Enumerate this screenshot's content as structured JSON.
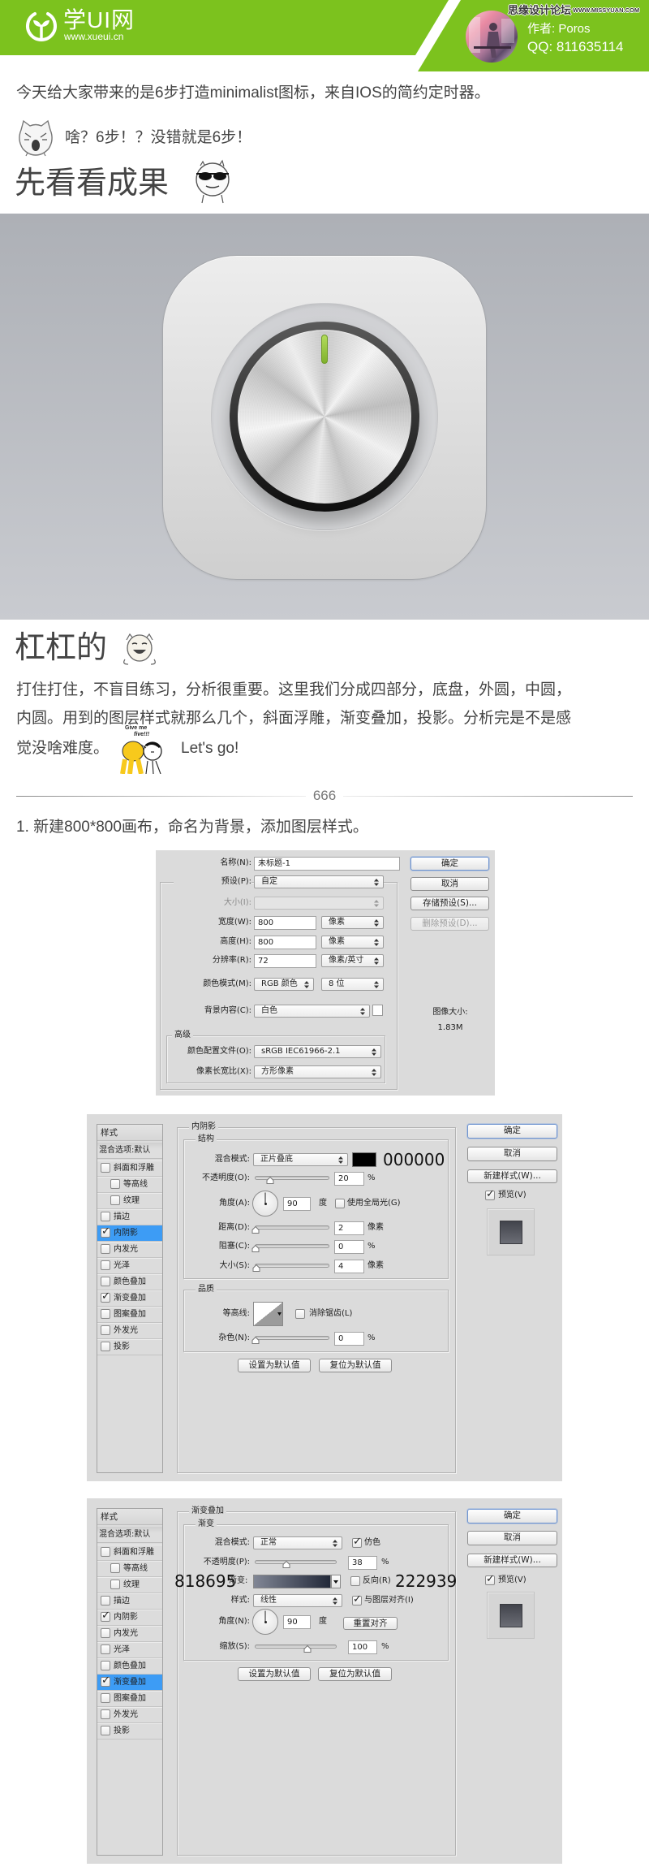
{
  "header": {
    "brand_color": "#7cc21e",
    "logo_text": "学UI网",
    "logo_domain": "www.xueui.cn",
    "forum_name": "思缘设计论坛",
    "forum_domain": "WWW.MISSYUAN.COM",
    "author_label": "作者:",
    "author_name": "Poros",
    "qq_label": "QQ:",
    "qq_number": "811635114"
  },
  "intro": {
    "line1": "今天给大家带来的是6步打造minimalist图标，来自IOS的简约定时器。",
    "line2": "啥？6步！？没错就是6步！"
  },
  "result_section": {
    "title": "先看看成果"
  },
  "analysis_section": {
    "title": "杠杠的",
    "lines": [
      "打住打住，不盲目练习，分析很重要。这里我们分成四部分，底盘，外圆，中圆，",
      "内圆。用到的图层样式就那么几个，斜面浮雕，渐变叠加，投影。分析完是不是感",
      "觉没啥难度。"
    ],
    "sticker_caption": [
      "Give me",
      "five!!!"
    ],
    "closing": "Let's go!"
  },
  "divider": {
    "label": "666"
  },
  "step1": {
    "text": "1. 新建800*800画布，命名为背景，添加图层样式。"
  },
  "new_doc_dialog": {
    "name": {
      "label": "名称(N):",
      "value": "未标题-1"
    },
    "preset": {
      "label": "预设(P):",
      "value": "自定"
    },
    "size": {
      "label": "大小(I):",
      "value": ""
    },
    "width": {
      "label": "宽度(W):",
      "value": "800",
      "unit": "像素"
    },
    "height": {
      "label": "高度(H):",
      "value": "800",
      "unit": "像素"
    },
    "resolution": {
      "label": "分辨率(R):",
      "value": "72",
      "unit": "像素/英寸"
    },
    "color_mode": {
      "label": "颜色模式(M):",
      "value": "RGB 颜色",
      "depth": "8 位"
    },
    "background": {
      "label": "背景内容(C):",
      "value": "白色",
      "swatch_color": "#ffffff"
    },
    "advanced": {
      "label": "高级",
      "color_profile": {
        "label": "颜色配置文件(O):",
        "value": "sRGB IEC61966-2.1"
      },
      "pixel_aspect": {
        "label": "像素长宽比(X):",
        "value": "方形像素"
      }
    },
    "buttons": {
      "ok": "确定",
      "cancel": "取消",
      "save_preset": "存储预设(S)...",
      "delete_preset": "删除预设(D)..."
    },
    "image_size": {
      "label": "图像大小:",
      "value": "1.83M"
    }
  },
  "inner_shadow_dialog": {
    "styles_header": "样式",
    "blending_options": "混合选项:默认",
    "styles": [
      {
        "label": "斜面和浮雕",
        "checked": false,
        "indent": false,
        "selected": false
      },
      {
        "label": "等高线",
        "checked": false,
        "indent": true,
        "selected": false
      },
      {
        "label": "纹理",
        "checked": false,
        "indent": true,
        "selected": false
      },
      {
        "label": "描边",
        "checked": false,
        "indent": false,
        "selected": false
      },
      {
        "label": "内阴影",
        "checked": true,
        "indent": false,
        "selected": true
      },
      {
        "label": "内发光",
        "checked": false,
        "indent": false,
        "selected": false
      },
      {
        "label": "光泽",
        "checked": false,
        "indent": false,
        "selected": false
      },
      {
        "label": "颜色叠加",
        "checked": false,
        "indent": false,
        "selected": false
      },
      {
        "label": "渐变叠加",
        "checked": true,
        "indent": false,
        "selected": false
      },
      {
        "label": "图案叠加",
        "checked": false,
        "indent": false,
        "selected": false
      },
      {
        "label": "外发光",
        "checked": false,
        "indent": false,
        "selected": false
      },
      {
        "label": "投影",
        "checked": false,
        "indent": false,
        "selected": false
      }
    ],
    "panel_title": "内阴影",
    "structure": {
      "title": "结构",
      "blend_mode": {
        "label": "混合模式:",
        "value": "正片叠底",
        "color": "#000000",
        "color_note": "000000"
      },
      "opacity": {
        "label": "不透明度(O):",
        "value": 20,
        "min": 0,
        "max": 100,
        "unit": "%"
      },
      "angle": {
        "label": "角度(A):",
        "value": 90,
        "unit": "度",
        "global_light": {
          "label": "使用全局光(G)",
          "checked": false
        }
      },
      "distance": {
        "label": "距离(D):",
        "value": 2,
        "min": 0,
        "max": 30000,
        "unit": "像素"
      },
      "choke": {
        "label": "阻塞(C):",
        "value": 0,
        "min": 0,
        "max": 100,
        "unit": "%"
      },
      "size": {
        "label": "大小(S):",
        "value": 4,
        "min": 0,
        "max": 250,
        "unit": "像素"
      }
    },
    "quality": {
      "title": "品质",
      "contour": {
        "label": "等高线:",
        "anti_alias": {
          "label": "消除锯齿(L)",
          "checked": false
        }
      },
      "noise": {
        "label": "杂色(N):",
        "value": 0,
        "min": 0,
        "max": 100,
        "unit": "%"
      }
    },
    "buttons": {
      "make_default": "设置为默认值",
      "reset_default": "复位为默认值",
      "ok": "确定",
      "cancel": "取消",
      "new_style": "新建样式(W)..."
    },
    "preview": {
      "label": "预览(V)",
      "checked": true
    }
  },
  "gradient_overlay_dialog": {
    "styles_header": "样式",
    "blending_options": "混合选项:默认",
    "styles": [
      {
        "label": "斜面和浮雕",
        "checked": false,
        "indent": false,
        "selected": false
      },
      {
        "label": "等高线",
        "checked": false,
        "indent": true,
        "selected": false
      },
      {
        "label": "纹理",
        "checked": false,
        "indent": true,
        "selected": false
      },
      {
        "label": "描边",
        "checked": false,
        "indent": false,
        "selected": false
      },
      {
        "label": "内阴影",
        "checked": true,
        "indent": false,
        "selected": false
      },
      {
        "label": "内发光",
        "checked": false,
        "indent": false,
        "selected": false
      },
      {
        "label": "光泽",
        "checked": false,
        "indent": false,
        "selected": false
      },
      {
        "label": "颜色叠加",
        "checked": false,
        "indent": false,
        "selected": false
      },
      {
        "label": "渐变叠加",
        "checked": true,
        "indent": false,
        "selected": true
      },
      {
        "label": "图案叠加",
        "checked": false,
        "indent": false,
        "selected": false
      },
      {
        "label": "外发光",
        "checked": false,
        "indent": false,
        "selected": false
      },
      {
        "label": "投影",
        "checked": false,
        "indent": false,
        "selected": false
      }
    ],
    "panel_title": "渐变叠加",
    "gradient_group": {
      "title": "渐变",
      "blend_mode": {
        "label": "混合模式:",
        "value": "正常",
        "dither": {
          "label": "仿色",
          "checked": true
        }
      },
      "opacity": {
        "label": "不透明度(P):",
        "value": 38,
        "min": 0,
        "max": 100,
        "unit": "%"
      },
      "gradient": {
        "label": "渐变:",
        "start_color": "#818695",
        "end_color": "#222939",
        "start_note": "818695",
        "end_note": "222939",
        "reverse": {
          "label": "反向(R)",
          "checked": false
        }
      },
      "style": {
        "label": "样式:",
        "value": "线性",
        "align": {
          "label": "与图层对齐(I)",
          "checked": true
        }
      },
      "angle": {
        "label": "角度(N):",
        "value": 90,
        "unit": "度",
        "reset_button": "重置对齐"
      },
      "scale": {
        "label": "缩放(S):",
        "value": 100,
        "min": 10,
        "max": 150,
        "unit": "%"
      }
    },
    "buttons": {
      "make_default": "设置为默认值",
      "reset_default": "复位为默认值",
      "ok": "确定",
      "cancel": "取消",
      "new_style": "新建样式(W)..."
    },
    "preview": {
      "label": "预览(V)",
      "checked": true
    }
  }
}
